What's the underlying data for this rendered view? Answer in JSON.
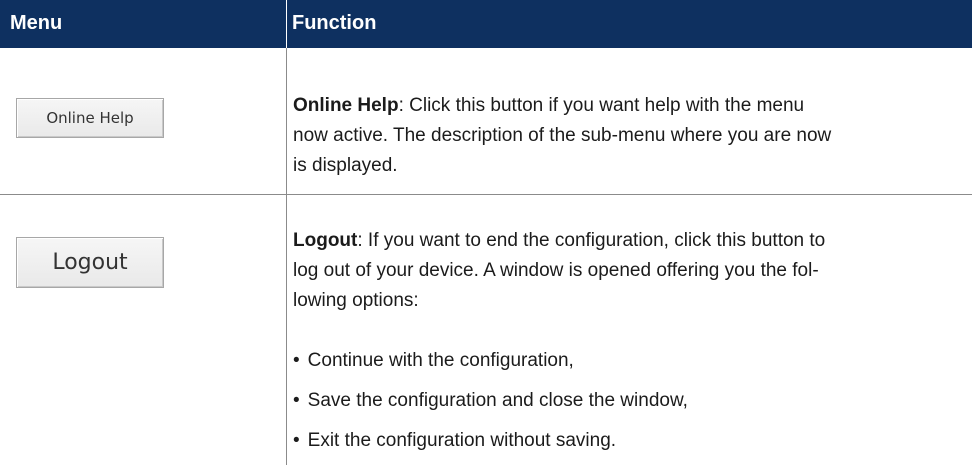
{
  "header": {
    "menu": "Menu",
    "function": "Function"
  },
  "rows": [
    {
      "button_label": "Online Help",
      "title": "Online Help",
      "line1": ": Click this button if you want help with the menu",
      "line2": "now active. The description of the sub-menu where you are now",
      "line3": "is displayed."
    },
    {
      "button_label": "Logout",
      "title": "Logout",
      "line1": ": If you want to end the configuration, click this button to",
      "line2": "log out of your device. A window is opened offering you the fol-",
      "line3": "lowing options:",
      "bullets": [
        "Continue with the configuration,",
        "Save the configuration and close the window,",
        "Exit the configuration without saving."
      ]
    }
  ],
  "colors": {
    "header_bg": "#0e3060",
    "header_text": "#ffffff",
    "divider": "#8b8b8b"
  }
}
